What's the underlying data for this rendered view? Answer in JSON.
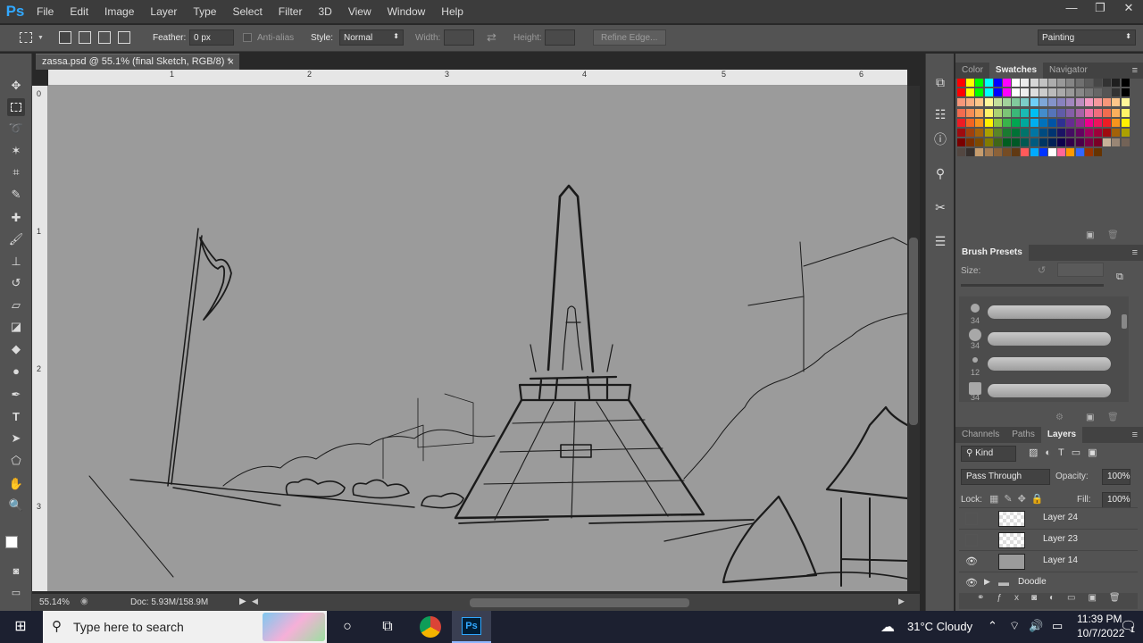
{
  "app": {
    "logo": "Ps"
  },
  "menu": [
    "File",
    "Edit",
    "Image",
    "Layer",
    "Type",
    "Select",
    "Filter",
    "3D",
    "View",
    "Window",
    "Help"
  ],
  "window_controls": {
    "minimize": "—",
    "restore": "❐",
    "close": "✕"
  },
  "options": {
    "feather_label": "Feather:",
    "feather_value": "0 px",
    "antialias_label": "Anti-alias",
    "style_label": "Style:",
    "style_value": "Normal",
    "width_label": "Width:",
    "height_label": "Height:",
    "refine_label": "Refine Edge...",
    "workspace": "Painting"
  },
  "document": {
    "tab_title": "zassa.psd @ 55.1% (final Sketch, RGB/8) *",
    "close": "×",
    "ruler_top": [
      "1",
      "2",
      "3",
      "4",
      "5",
      "6"
    ],
    "ruler_left": [
      "0",
      "1",
      "2",
      "3"
    ],
    "zoom": "55.14%",
    "doc_size": "Doc: 5.93M/158.9M"
  },
  "tools": [
    "move-tool",
    "marquee-tool",
    "lasso-tool",
    "magic-wand-tool",
    "crop-tool",
    "eyedropper-tool",
    "healing-tool",
    "brush-tool",
    "stamp-tool",
    "history-brush-tool",
    "eraser-tool",
    "gradient-tool",
    "blur-tool",
    "dodge-tool",
    "pen-tool",
    "type-tool",
    "path-select-tool",
    "shape-tool",
    "hand-tool",
    "zoom-tool"
  ],
  "panels": {
    "color_tabs": [
      "Color",
      "Swatches",
      "Navigator"
    ],
    "brush_title": "Brush Presets",
    "size_label": "Size:",
    "brush_sizes": [
      "34",
      "34",
      "12",
      "34"
    ],
    "layer_tabs": [
      "Channels",
      "Paths",
      "Layers"
    ],
    "kind_label": "Kind",
    "blend_mode": "Pass Through",
    "opacity_label": "Opacity:",
    "opacity_value": "100%",
    "lock_label": "Lock:",
    "fill_label": "Fill:",
    "fill_value": "100%",
    "layers": [
      {
        "name": "Layer 24",
        "visible": false
      },
      {
        "name": "Layer 23",
        "visible": false
      },
      {
        "name": "Layer 14",
        "visible": true
      },
      {
        "name": "Doodle",
        "visible": true,
        "group": true
      }
    ]
  },
  "taskbar": {
    "search_placeholder": "Type here to search",
    "weather": "31°C  Cloudy",
    "time": "11:39 PM",
    "date": "10/7/2022",
    "notifications": "1"
  }
}
